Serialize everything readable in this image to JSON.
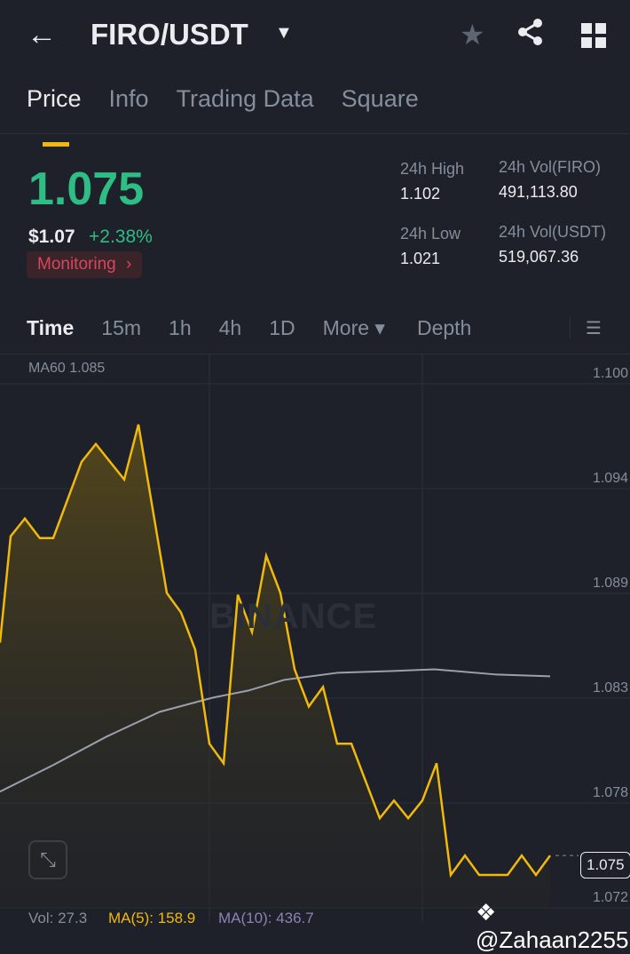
{
  "header": {
    "title": "FIRO/USDT",
    "back_icon": "arrow-left",
    "star_icon": "star",
    "share_icon": "share",
    "grid_icon": "grid"
  },
  "tabs": [
    {
      "label": "Price",
      "active": true
    },
    {
      "label": "Info"
    },
    {
      "label": "Trading Data"
    },
    {
      "label": "Square"
    }
  ],
  "ticker": {
    "last_price": "1.075",
    "usd_price": "$1.07",
    "change": "+2.38%",
    "monitoring": "Monitoring",
    "monitoring_chevron": "›",
    "high_label": "24h High",
    "high": "1.102",
    "low_label": "24h Low",
    "low": "1.021",
    "vol_base_label": "24h Vol(FIRO)",
    "vol_base": "491,113.80",
    "vol_quote_label": "24h Vol(USDT)",
    "vol_quote": "519,067.36"
  },
  "intervals": [
    {
      "label": "Time",
      "active": true
    },
    {
      "label": "15m"
    },
    {
      "label": "1h"
    },
    {
      "label": "4h"
    },
    {
      "label": "1D"
    },
    {
      "label": "More ▾"
    },
    {
      "label": "Depth"
    }
  ],
  "chart_data": {
    "type": "line",
    "ma60_label": "MA60 1.085",
    "y_ticks": [
      "1.100",
      "1.094",
      "1.089",
      "1.083",
      "1.078",
      "1.072"
    ],
    "ylim": [
      1.0715,
      1.1005
    ],
    "price_x": [
      0,
      0.75,
      1.75,
      2.8,
      3.75,
      5.75,
      6.75,
      8.75,
      9.75,
      11.75,
      12.75,
      13.75,
      14.75,
      15.75,
      16.75,
      17.75,
      18.75,
      19.75,
      20.75,
      21.75,
      22.75,
      23.75,
      24.75,
      26.75,
      27.75,
      28.75,
      29.75,
      30.75,
      31.75,
      32.75,
      33.75,
      35.75,
      36.75,
      37.75,
      38.75
    ],
    "price": [
      1.0859,
      1.0919,
      1.0929,
      1.0918,
      1.0918,
      1.0961,
      1.0971,
      1.0951,
      1.0982,
      1.0887,
      1.0876,
      1.0855,
      1.0802,
      1.0791,
      1.0886,
      1.0865,
      1.0908,
      1.0887,
      1.0844,
      1.0823,
      1.0834,
      1.0802,
      1.0802,
      1.076,
      1.077,
      1.076,
      1.077,
      1.0791,
      1.0728,
      1.0739,
      1.0728,
      1.0728,
      1.0739,
      1.0728,
      1.0739
    ],
    "ma60_x": [
      0,
      3.75,
      7.5,
      11.25,
      15,
      17.5,
      20,
      23.75,
      27.5,
      30.6,
      35,
      38.75
    ],
    "ma60": [
      1.0775,
      1.079,
      1.0806,
      1.082,
      1.0828,
      1.0832,
      1.0838,
      1.0842,
      1.0843,
      1.0844,
      1.0841,
      1.084
    ],
    "last_label": "1.075",
    "price_color": "#f0b90b",
    "ma60_color": "#9aa0ad"
  },
  "volume": {
    "vol": "Vol: 27.3",
    "ma5": "MA(5): 158.9",
    "ma10": "MA(10): 436.7"
  },
  "watermark": "BINANCE",
  "handle": "@Zahaan2255"
}
